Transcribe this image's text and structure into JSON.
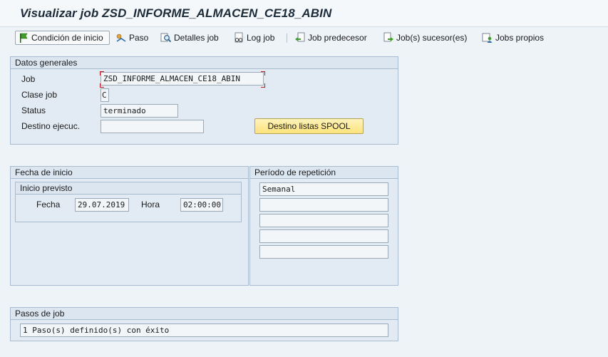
{
  "window": {
    "title": "Visualizar job ZSD_INFORME_ALMACEN_CE18_ABIN"
  },
  "toolbar": {
    "condicion_inicio": "Condición de inicio",
    "paso": "Paso",
    "detalles_job": "Detalles job",
    "log_job": "Log job",
    "job_predecesor": "Job predecesor",
    "jobs_sucesores": "Job(s) sucesor(es)",
    "jobs_propios": "Jobs propios"
  },
  "datos_generales": {
    "title": "Datos generales",
    "job_label": "Job",
    "job_value": "ZSD_INFORME_ALMACEN_CE18_ABIN",
    "clase_label": "Clase job",
    "clase_value": "C",
    "status_label": "Status",
    "status_value": "terminado",
    "destino_label": "Destino ejecuc.",
    "destino_value": "",
    "spool_button": "Destino listas SPOOL"
  },
  "fecha_inicio": {
    "title": "Fecha de inicio",
    "inicio_previsto_title": "Inicio previsto",
    "fecha_label": "Fecha",
    "fecha_value": "29.07.2019",
    "hora_label": "Hora",
    "hora_value": "02:00:00"
  },
  "periodo": {
    "title": "Período de repetición",
    "rows": [
      "Semanal",
      "",
      "",
      "",
      ""
    ]
  },
  "pasos": {
    "title": "Pasos de job",
    "value": "1 Paso(s) definido(s) con éxito"
  }
}
